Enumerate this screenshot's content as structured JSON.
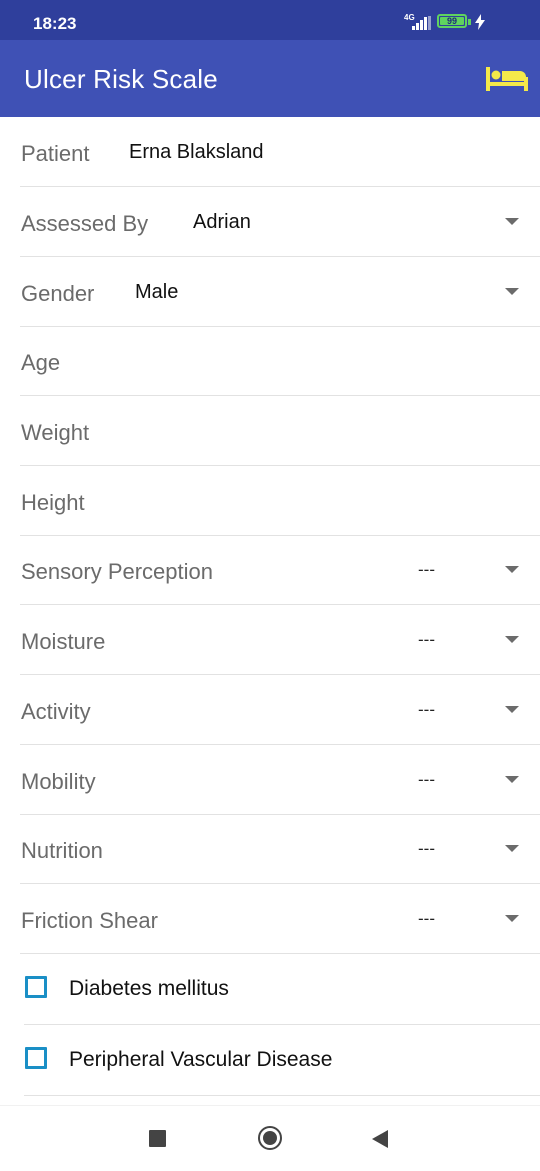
{
  "status_bar": {
    "time": "18:23",
    "network": "4G",
    "battery_level": "99",
    "signal_icon": "signal-icon",
    "charging_icon": "charging-icon",
    "battery_color": "#5fd35f"
  },
  "app_bar": {
    "title": "Ulcer Risk Scale",
    "action_icon": "bed-icon",
    "color": "#3f51b5",
    "icon_color": "#f4e94a"
  },
  "form": {
    "patient": {
      "label": "Patient",
      "value": "Erna Blaksland"
    },
    "assessed_by": {
      "label": "Assessed By",
      "value": "Adrian"
    },
    "gender": {
      "label": "Gender",
      "value": "Male"
    },
    "age": {
      "label": "Age",
      "value": ""
    },
    "weight": {
      "label": "Weight",
      "value": ""
    },
    "height": {
      "label": "Height",
      "value": ""
    },
    "scales": [
      {
        "label": "Sensory Perception",
        "value": "---"
      },
      {
        "label": "Moisture",
        "value": "---"
      },
      {
        "label": "Activity",
        "value": "---"
      },
      {
        "label": "Mobility",
        "value": "---"
      },
      {
        "label": "Nutrition",
        "value": "---"
      },
      {
        "label": "Friction Shear",
        "value": "---"
      }
    ],
    "conditions": [
      {
        "label": "Diabetes mellitus",
        "checked": false
      },
      {
        "label": "Peripheral Vascular Disease",
        "checked": false
      }
    ]
  },
  "nav_bar": {
    "recents_icon": "recents-icon",
    "home_icon": "home-icon",
    "back_icon": "back-icon"
  }
}
